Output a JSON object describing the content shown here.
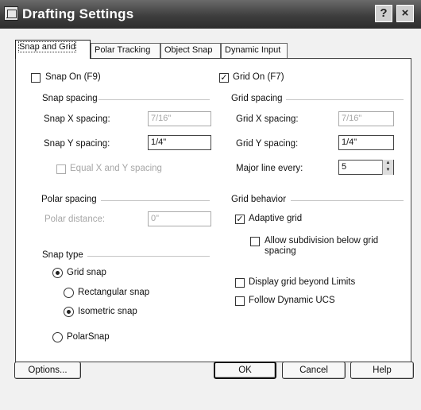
{
  "window": {
    "title": "Drafting Settings",
    "help_button": "?",
    "close_button": "×"
  },
  "tabs": [
    {
      "label": "Snap and Grid",
      "active": true
    },
    {
      "label": "Polar Tracking"
    },
    {
      "label": "Object Snap"
    },
    {
      "label": "Dynamic Input"
    }
  ],
  "snap": {
    "snap_on_label": "Snap On (F9)",
    "snap_on_checked": false,
    "spacing_group": "Snap spacing",
    "x_label": "Snap X spacing:",
    "x_value": "7/16\"",
    "y_label": "Snap Y spacing:",
    "y_value": "1/4\"",
    "equal_label": "Equal X and Y spacing"
  },
  "polar": {
    "group": "Polar spacing",
    "distance_label": "Polar distance:",
    "distance_value": "0\""
  },
  "snap_type": {
    "group": "Snap type",
    "grid_snap": "Grid snap",
    "rectangular": "Rectangular snap",
    "isometric": "Isometric snap",
    "polarsnap": "PolarSnap",
    "selected": "isometric"
  },
  "grid": {
    "grid_on_label": "Grid On (F7)",
    "grid_on_checked": true,
    "spacing_group": "Grid spacing",
    "x_label": "Grid X spacing:",
    "x_value": "7/16\"",
    "y_label": "Grid Y spacing:",
    "y_value": "1/4\"",
    "major_label": "Major line every:",
    "major_value": "5"
  },
  "grid_behavior": {
    "group": "Grid behavior",
    "adaptive": "Adaptive grid",
    "adaptive_checked": true,
    "subdivision": "Allow subdivision below grid spacing",
    "beyond_limits": "Display grid beyond Limits",
    "follow_ucs": "Follow Dynamic UCS"
  },
  "buttons": {
    "options": "Options...",
    "ok": "OK",
    "cancel": "Cancel",
    "help": "Help"
  },
  "check_mark": "✓"
}
